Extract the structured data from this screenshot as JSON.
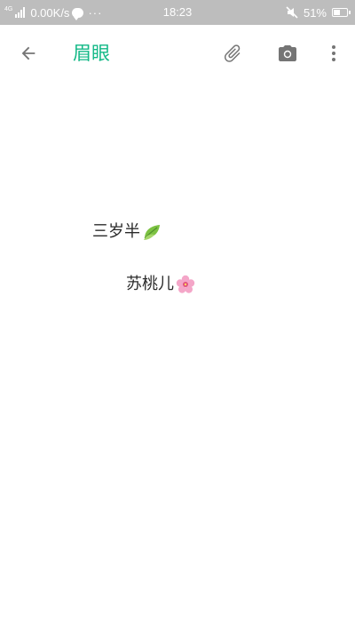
{
  "status_bar": {
    "network": "4G",
    "speed": "0.00K/s",
    "more": "···",
    "time": "18:23",
    "battery_level": "51%",
    "battery_fraction": 0.51
  },
  "toolbar": {
    "title": "眉眼",
    "back_icon": "arrow-left-icon",
    "attach_icon": "paperclip-icon",
    "camera_icon": "camera-icon",
    "more_icon": "more-vert-icon",
    "title_color": "#12b886"
  },
  "note": {
    "lines": [
      {
        "text": "三岁半",
        "emoji": "leaf-emoji"
      },
      {
        "text": "苏桃儿",
        "emoji": "cherry-blossom-emoji"
      }
    ]
  }
}
